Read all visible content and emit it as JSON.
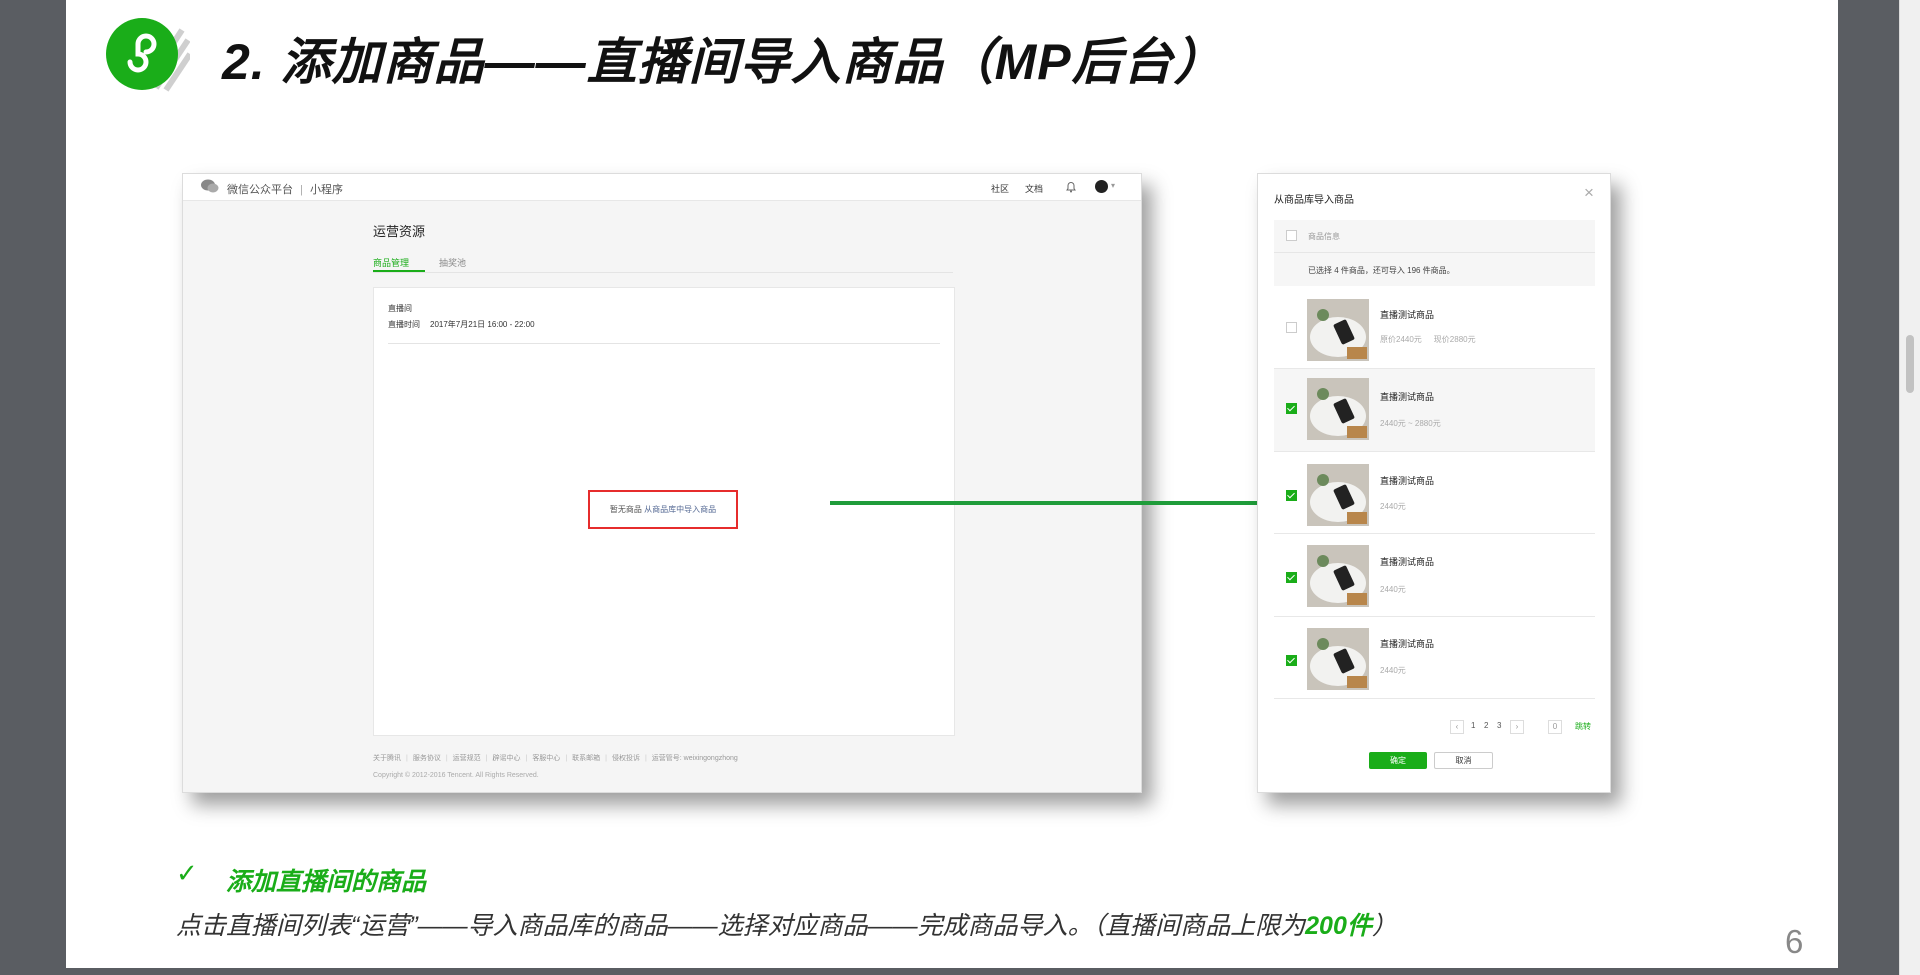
{
  "slide": {
    "title": "2. 添加商品——直播间导入商品（MP后台）",
    "subheading_check": "✓",
    "subheading": "添加直播间的商品",
    "description_prefix": "点击直播间列表“运营”——导入商品库的商品——选择对应商品——完成商品导入。（直播间商品上限为",
    "description_highlight": "200件",
    "description_suffix": "）",
    "page_number": "6",
    "accent_color": "#1aad19",
    "highlight_border_color": "#e62c2c"
  },
  "mp_window": {
    "brand": "微信公众平台",
    "brand_separator": "|",
    "product": "小程序",
    "top_links": [
      "社区",
      "文档"
    ],
    "page_title": "运营资源",
    "tabs": [
      "商品管理",
      "抽奖池"
    ],
    "room_label": "直播间",
    "time_label": "直播时间",
    "time_value": "2017年7月21日 16:00 - 22:00",
    "empty_text": "暂无商品",
    "import_link": "从商品库中导入商品",
    "footer_links": [
      "关于腾讯",
      "服务协议",
      "运营规范",
      "辟谣中心",
      "客服中心",
      "联系邮箱",
      "侵权投诉",
      "运营管号: weixingongzhong"
    ],
    "copyright": "Copyright © 2012-2016 Tencent. All Rights Reserved."
  },
  "import_modal": {
    "title": "从商品库导入商品",
    "close": "×",
    "header_label": "商品信息",
    "selection_summary": "已选择 4 件商品，还可导入 196 件商品。",
    "items": [
      {
        "name": "直播测试商品",
        "price": "原价2440元",
        "price2": "现价2880元",
        "checked": false
      },
      {
        "name": "直播测试商品",
        "price": "2440元 ~ 2880元",
        "price2": "",
        "checked": true
      },
      {
        "name": "直播测试商品",
        "price": "2440元",
        "price2": "",
        "checked": true
      },
      {
        "name": "直播测试商品",
        "price": "2440元",
        "price2": "",
        "checked": true
      },
      {
        "name": "直播测试商品",
        "price": "2440元",
        "price2": "",
        "checked": true
      }
    ],
    "pager": {
      "prev": "‹",
      "pages": [
        "1",
        "2",
        "3"
      ],
      "next": "›",
      "input": "0",
      "go": "跳转"
    },
    "confirm": "确定",
    "cancel": "取消"
  }
}
